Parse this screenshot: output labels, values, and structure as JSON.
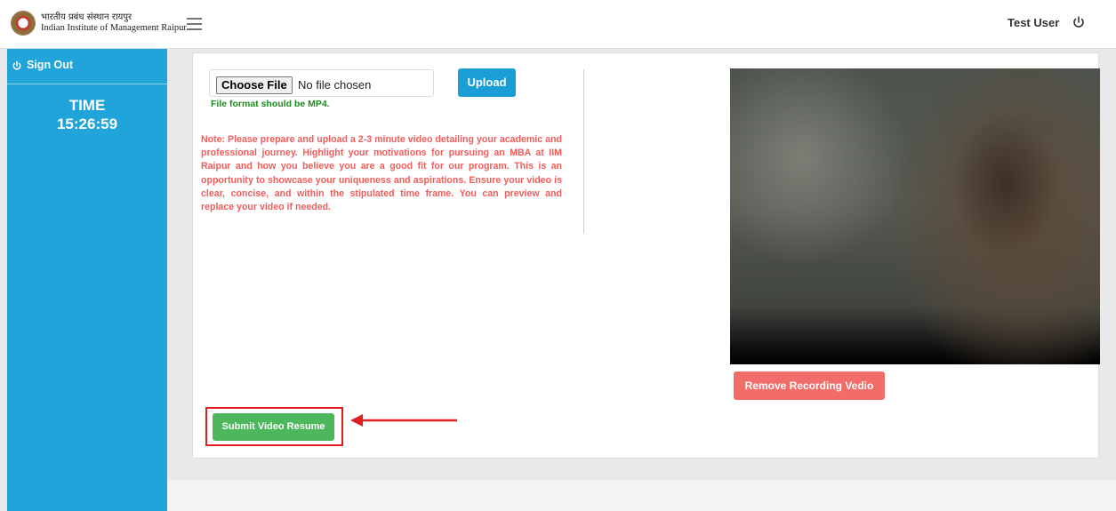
{
  "header": {
    "logo_hindi": "भारतीय प्रबंध संस्थान रायपुर",
    "logo_english": "Indian Institute of Management Raipur",
    "menu_icon": "hamburger-icon",
    "user_name": "Test User",
    "power_icon": "power-icon"
  },
  "sidebar": {
    "signout_label": "Sign Out",
    "signout_icon": "power-icon",
    "time_label": "TIME",
    "time_value": "15:26:59",
    "bg_color": "#21a4d9"
  },
  "upload": {
    "choose_button": "Choose File",
    "file_status": "No file chosen",
    "upload_button": "Upload",
    "format_hint": "File format should be MP4.",
    "note": "Note: Please prepare and upload a 2-3 minute video detailing your academic and professional journey. Highlight your motivations for pursuing an MBA at IIM Raipur and how you believe you are a good fit for our program. This is an opportunity to showcase your uniqueness and aspirations. Ensure your video is clear, concise, and within the stipulated time frame. You can preview and replace your video if needed."
  },
  "video": {
    "remove_button": "Remove Recording Vedio"
  },
  "actions": {
    "submit_button": "Submit Video Resume",
    "annotation_color": "#e02020"
  },
  "colors": {
    "primary_blue": "#1b9dd6",
    "success_green": "#4cb75c",
    "danger_red": "#f26c6a",
    "note_red": "#f05d5b",
    "hint_green": "#1c8a1c"
  }
}
